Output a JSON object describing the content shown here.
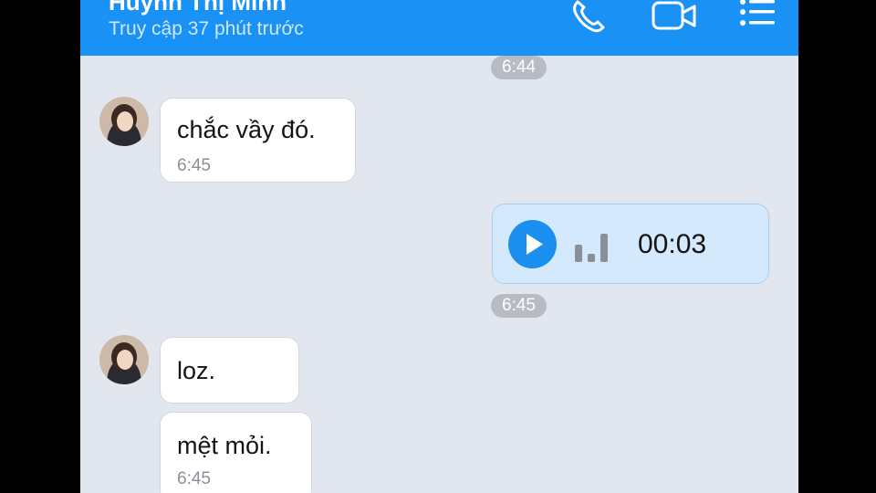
{
  "header": {
    "contact_name": "Huỳnh Thị Minh",
    "last_seen": "Truy cập 37 phút trước",
    "icons": [
      "phone-icon",
      "video-call-icon",
      "menu-list-icon"
    ],
    "accent_color": "#1a92f5"
  },
  "messages": {
    "time_divider_1": "6:44",
    "msg1": {
      "text": "chắc vầy đó.",
      "time": "6:45"
    },
    "voice": {
      "duration": "00:03",
      "icon": "play-icon"
    },
    "time_divider_2": "6:45",
    "msg2": {
      "text": "loz."
    },
    "msg3": {
      "text": "mệt mỏi.",
      "time": "6:45"
    }
  }
}
